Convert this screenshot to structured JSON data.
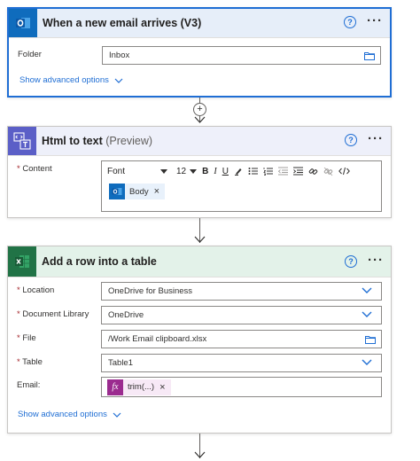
{
  "card1": {
    "title": "When a new email arrives (V3)",
    "folder_label": "Folder",
    "folder_value": "Inbox",
    "show_advanced": "Show advanced options"
  },
  "card2": {
    "title": "Html to text",
    "title_suffix": "(Preview)",
    "content_label": "Content",
    "font_label": "Font",
    "font_size": "12",
    "token_label": "Body"
  },
  "card3": {
    "title": "Add a row into a table",
    "fields": [
      {
        "label": "Location",
        "required": true,
        "value": "OneDrive for Business",
        "kind": "dropdown"
      },
      {
        "label": "Document Library",
        "required": true,
        "value": "OneDrive",
        "kind": "dropdown"
      },
      {
        "label": "File",
        "required": true,
        "value": "/Work Email clipboard.xlsx",
        "kind": "file"
      },
      {
        "label": "Table",
        "required": true,
        "value": "Table1",
        "kind": "dropdown"
      }
    ],
    "email_label": "Email:",
    "email_token": "trim(...)",
    "show_advanced": "Show advanced options"
  },
  "common": {
    "required_mark": "*",
    "help_glyph": "?",
    "more_glyph": "···",
    "remove_glyph": "×",
    "plus_glyph": "+"
  },
  "colors": {
    "accent": "#1f6ed4",
    "outlook": "#0f6cbd",
    "html_icon": "#5b5fc7",
    "excel": "#217346",
    "expression": "#9b2b8f"
  },
  "icons": [
    "outlook-icon",
    "html-to-text-icon",
    "excel-icon",
    "help-icon",
    "more-icon",
    "folder-icon",
    "chevron-down-icon",
    "expression-icon",
    "close-icon",
    "add-step-icon",
    "arrow-down-icon"
  ]
}
